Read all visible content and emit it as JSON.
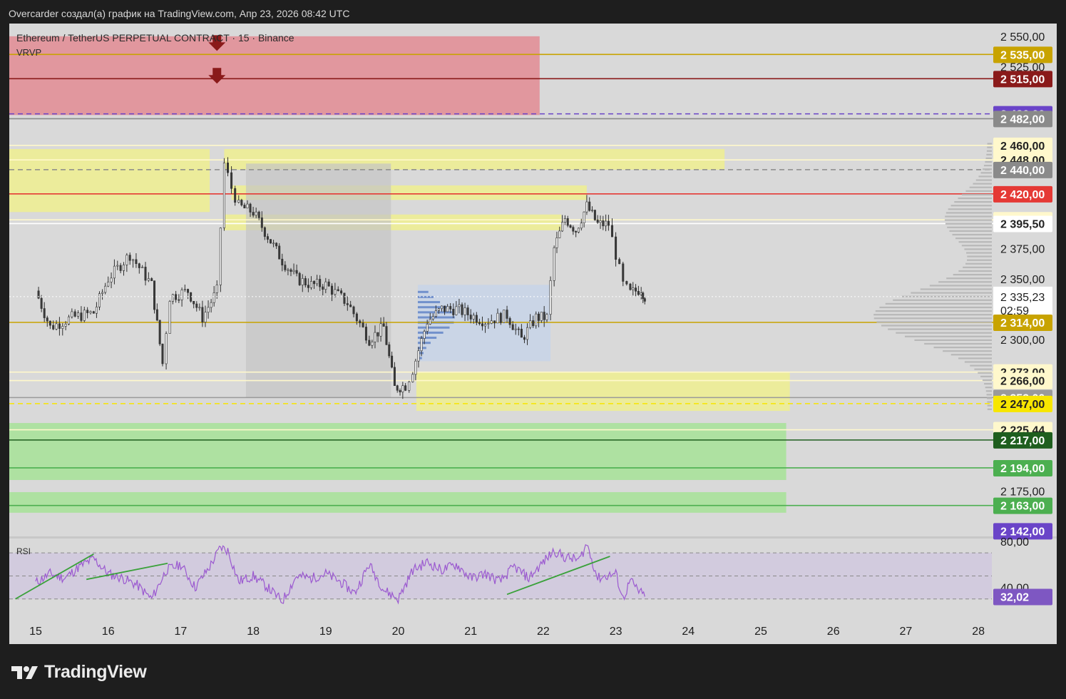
{
  "header": {
    "text": "Overcarder создал(а) график на TradingView.com, Апр 23, 2026 08:42 UTC"
  },
  "chart": {
    "title": "Ethereum / TetherUS PERPETUAL CONTRACT · 15 · Binance",
    "indicator_label": "VRVP",
    "rsi_label": "RSI"
  },
  "brand": {
    "name": "TradingView"
  },
  "colors": {
    "background": "#d9d9d9",
    "candle_up": "#2e2e2e",
    "candle_down": "#3b3b3b",
    "resistance_zone": "#e2949b",
    "supply_zone": "#eded94",
    "demand_zone": "#a9e19a",
    "rsi_line": "#9b59d0",
    "rsi_band": "#d0c9de",
    "trendline": "#3aa13a",
    "volume_profile": "#b8b8b8",
    "value_area": "#c7d3e8"
  },
  "chart_data": {
    "type": "candlestick",
    "symbol": "ETHUSDT.P",
    "interval": "15",
    "exchange": "Binance",
    "x_ticks": [
      "15",
      "16",
      "17",
      "18",
      "19",
      "20",
      "21",
      "22",
      "23",
      "24",
      "25",
      "26",
      "27",
      "28"
    ],
    "y_range": [
      2142,
      2550
    ],
    "y_ticks": [
      "2 550,00",
      "2 525,00",
      "2 375,00",
      "2 350,00",
      "2 300,00",
      "2 175,00"
    ],
    "price_path": [
      [
        15.0,
        2340
      ],
      [
        15.2,
        2310
      ],
      [
        15.5,
        2318
      ],
      [
        15.8,
        2322
      ],
      [
        16.0,
        2350
      ],
      [
        16.3,
        2370
      ],
      [
        16.6,
        2345
      ],
      [
        16.75,
        2280
      ],
      [
        16.85,
        2335
      ],
      [
        17.1,
        2340
      ],
      [
        17.3,
        2318
      ],
      [
        17.5,
        2340
      ],
      [
        17.6,
        2445
      ],
      [
        17.7,
        2425
      ],
      [
        17.8,
        2410
      ],
      [
        18.0,
        2405
      ],
      [
        18.2,
        2385
      ],
      [
        18.4,
        2365
      ],
      [
        18.6,
        2350
      ],
      [
        18.8,
        2345
      ],
      [
        19.0,
        2345
      ],
      [
        19.3,
        2330
      ],
      [
        19.6,
        2300
      ],
      [
        19.8,
        2310
      ],
      [
        19.95,
        2260
      ],
      [
        20.1,
        2262
      ],
      [
        20.2,
        2275
      ],
      [
        20.4,
        2315
      ],
      [
        20.6,
        2325
      ],
      [
        20.8,
        2325
      ],
      [
        21.0,
        2320
      ],
      [
        21.2,
        2315
      ],
      [
        21.5,
        2320
      ],
      [
        21.7,
        2300
      ],
      [
        21.9,
        2318
      ],
      [
        22.05,
        2318
      ],
      [
        22.15,
        2375
      ],
      [
        22.3,
        2400
      ],
      [
        22.45,
        2390
      ],
      [
        22.6,
        2410
      ],
      [
        22.75,
        2395
      ],
      [
        22.9,
        2395
      ],
      [
        23.0,
        2370
      ],
      [
        23.1,
        2345
      ],
      [
        23.2,
        2338
      ],
      [
        23.35,
        2342
      ],
      [
        23.4,
        2335.23
      ]
    ],
    "last_price": "2 335,23",
    "countdown": "02:59",
    "price_labels": [
      {
        "text": "2 535,00",
        "bg": "#c8a300",
        "fg": "#ffffff",
        "price": 2535
      },
      {
        "text": "2 515,00",
        "bg": "#8a1a1a",
        "fg": "#ffffff",
        "price": 2515
      },
      {
        "text": "2 486,00",
        "bg": "#6a44c8",
        "fg": "#ffffff",
        "price": 2486
      },
      {
        "text": "2 482,00",
        "bg": "#8a8a8a",
        "fg": "#ffffff",
        "price": 2482
      },
      {
        "text": "2 460,00",
        "bg": "#fff8cc",
        "fg": "#222222",
        "price": 2460
      },
      {
        "text": "2 448,00",
        "bg": "#fff8cc",
        "fg": "#222222",
        "price": 2448
      },
      {
        "text": "2 440,00",
        "bg": "#8a8a8a",
        "fg": "#ffffff",
        "price": 2440
      },
      {
        "text": "2 420,00",
        "bg": "#e53935",
        "fg": "#ffffff",
        "price": 2420
      },
      {
        "text": "2 398,60",
        "bg": "#fff8cc",
        "fg": "#222222",
        "price": 2398.6
      },
      {
        "text": "2 395,50",
        "bg": "#ffffff",
        "fg": "#222222",
        "price": 2395.5
      },
      {
        "text": "2 314,00",
        "bg": "#c8a300",
        "fg": "#ffffff",
        "price": 2314
      },
      {
        "text": "2 273,00",
        "bg": "#fff8cc",
        "fg": "#222222",
        "price": 2273
      },
      {
        "text": "2 266,00",
        "bg": "#fff8cc",
        "fg": "#222222",
        "price": 2266
      },
      {
        "text": "2 252,00",
        "bg": "#9a9a9a",
        "fg": "#ffffff",
        "price": 2252
      },
      {
        "text": "2 247,00",
        "bg": "#f7e600",
        "fg": "#222222",
        "price": 2247
      },
      {
        "text": "2 225,44",
        "bg": "#fff8cc",
        "fg": "#222222",
        "price": 2225.44
      },
      {
        "text": "2 217,00",
        "bg": "#1e5e1e",
        "fg": "#ffffff",
        "price": 2217
      },
      {
        "text": "2 194,00",
        "bg": "#4caf50",
        "fg": "#ffffff",
        "price": 2194
      },
      {
        "text": "2 163,00",
        "bg": "#4caf50",
        "fg": "#ffffff",
        "price": 2163
      },
      {
        "text": "2 142,00",
        "bg": "#6a44c8",
        "fg": "#ffffff",
        "price": 2142
      }
    ],
    "horizontal_lines": [
      {
        "price": 2535,
        "color": "#c8a300",
        "style": "solid"
      },
      {
        "price": 2515,
        "color": "#8a1a1a",
        "style": "solid"
      },
      {
        "price": 2486,
        "color": "#6a44c8",
        "style": "dashed"
      },
      {
        "price": 2482,
        "color": "#8a8a8a",
        "style": "solid"
      },
      {
        "price": 2460,
        "color": "#fff8cc",
        "style": "solid"
      },
      {
        "price": 2448,
        "color": "#fff8cc",
        "style": "solid"
      },
      {
        "price": 2440,
        "color": "#8a8a8a",
        "style": "dashed"
      },
      {
        "price": 2420,
        "color": "#e53935",
        "style": "solid"
      },
      {
        "price": 2398.6,
        "color": "#fff8cc",
        "style": "solid"
      },
      {
        "price": 2395.5,
        "color": "#ffffff",
        "style": "solid"
      },
      {
        "price": 2314,
        "color": "#c8a300",
        "style": "solid"
      },
      {
        "price": 2273,
        "color": "#fff8cc",
        "style": "solid"
      },
      {
        "price": 2266,
        "color": "#fff8cc",
        "style": "solid"
      },
      {
        "price": 2252,
        "color": "#9a9a9a",
        "style": "solid"
      },
      {
        "price": 2247,
        "color": "#f7e600",
        "style": "dashed"
      },
      {
        "price": 2225.44,
        "color": "#fff8cc",
        "style": "solid"
      },
      {
        "price": 2217,
        "color": "#1e5e1e",
        "style": "solid"
      },
      {
        "price": 2194,
        "color": "#4caf50",
        "style": "solid"
      },
      {
        "price": 2163,
        "color": "#4caf50",
        "style": "solid"
      }
    ],
    "zones": [
      {
        "kind": "resistance",
        "x_from": 14.6,
        "x_to": 21.95,
        "price_top": 2550,
        "price_bottom": 2485,
        "color": "#e2949b"
      },
      {
        "kind": "supply",
        "x_from": 14.6,
        "x_to": 17.4,
        "price_top": 2457,
        "price_bottom": 2405,
        "color": "#eded94"
      },
      {
        "kind": "supply",
        "x_from": 17.6,
        "x_to": 24.5,
        "price_top": 2457,
        "price_bottom": 2440,
        "color": "#eded94"
      },
      {
        "kind": "supply",
        "x_from": 17.7,
        "x_to": 22.6,
        "price_top": 2427,
        "price_bottom": 2415,
        "color": "#eded94"
      },
      {
        "kind": "supply",
        "x_from": 17.6,
        "x_to": 22.25,
        "price_top": 2403,
        "price_bottom": 2390,
        "color": "#eded94"
      },
      {
        "kind": "supply",
        "x_from": 20.25,
        "x_to": 25.4,
        "price_top": 2273,
        "price_bottom": 2241,
        "color": "#eded94"
      },
      {
        "kind": "demand",
        "x_from": 14.6,
        "x_to": 25.35,
        "price_top": 2231,
        "price_bottom": 2184,
        "color": "#a9e19a"
      },
      {
        "kind": "demand",
        "x_from": 14.6,
        "x_to": 25.35,
        "price_top": 2174,
        "price_bottom": 2157,
        "color": "#a9e19a"
      }
    ],
    "rsi": {
      "range": [
        20,
        80
      ],
      "upper_band": 70,
      "mid": 50,
      "lower_band": 30,
      "last_value": "32,02",
      "path": [
        [
          15.0,
          44
        ],
        [
          15.2,
          52
        ],
        [
          15.4,
          48
        ],
        [
          15.6,
          58
        ],
        [
          15.8,
          65
        ],
        [
          16.0,
          52
        ],
        [
          16.2,
          48
        ],
        [
          16.4,
          42
        ],
        [
          16.6,
          30
        ],
        [
          16.8,
          55
        ],
        [
          17.0,
          60
        ],
        [
          17.2,
          40
        ],
        [
          17.4,
          58
        ],
        [
          17.55,
          75
        ],
        [
          17.65,
          72
        ],
        [
          17.8,
          45
        ],
        [
          18.0,
          50
        ],
        [
          18.2,
          40
        ],
        [
          18.4,
          28
        ],
        [
          18.6,
          50
        ],
        [
          18.8,
          48
        ],
        [
          19.0,
          52
        ],
        [
          19.2,
          45
        ],
        [
          19.4,
          35
        ],
        [
          19.6,
          60
        ],
        [
          19.8,
          38
        ],
        [
          20.0,
          30
        ],
        [
          20.2,
          55
        ],
        [
          20.4,
          62
        ],
        [
          20.6,
          55
        ],
        [
          20.8,
          60
        ],
        [
          21.0,
          48
        ],
        [
          21.2,
          52
        ],
        [
          21.4,
          45
        ],
        [
          21.6,
          58
        ],
        [
          21.8,
          48
        ],
        [
          22.0,
          62
        ],
        [
          22.15,
          72
        ],
        [
          22.3,
          66
        ],
        [
          22.5,
          64
        ],
        [
          22.6,
          78
        ],
        [
          22.75,
          48
        ],
        [
          23.0,
          52
        ],
        [
          23.1,
          30
        ],
        [
          23.2,
          46
        ],
        [
          23.3,
          38
        ],
        [
          23.4,
          32.02
        ]
      ],
      "y_ticks": [
        "80,00",
        "40,00"
      ],
      "trendlines": [
        {
          "from": [
            14.72,
            30
          ],
          "to": [
            15.8,
            69
          ]
        },
        {
          "from": [
            15.7,
            47
          ],
          "to": [
            16.82,
            61
          ]
        },
        {
          "from": [
            21.5,
            34
          ],
          "to": [
            22.92,
            67
          ]
        }
      ]
    },
    "volume_profile": {
      "visible": true,
      "side": "right"
    }
  }
}
